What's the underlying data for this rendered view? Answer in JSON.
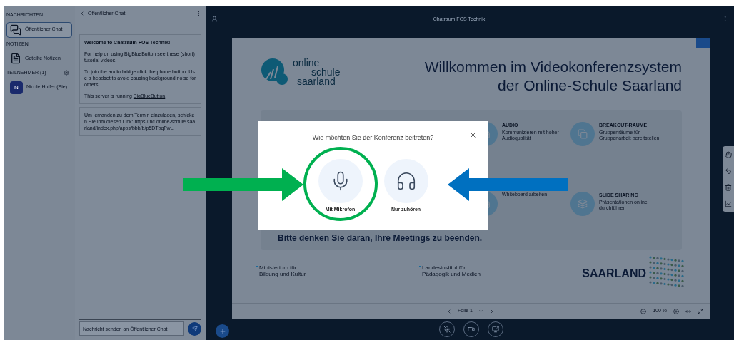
{
  "sidebar": {
    "sections": [
      {
        "title": "NACHRICHTEN",
        "items": [
          {
            "kind": "chat",
            "label": "Öffentlicher Chat",
            "selected": true
          }
        ]
      },
      {
        "title": "NOTIZEN",
        "items": [
          {
            "kind": "notes",
            "label": "Geteilte Notizen",
            "selected": false
          }
        ]
      },
      {
        "title": "TEILNEHMER (1)",
        "items": [
          {
            "kind": "user",
            "label": "Nicole Huffer (Sie)",
            "avatar": "N",
            "selected": false
          }
        ]
      }
    ]
  },
  "chat": {
    "title": "Öffentlicher Chat",
    "messages": [
      {
        "paragraphs": [
          {
            "kind": "bold",
            "before": "Welcome to Chatraum FOS Technik!"
          },
          {
            "kind": "plain",
            "before": "For help on using BigBlueButton see these (short) ",
            "link": "tutorial videos",
            "after": "."
          },
          {
            "kind": "plain",
            "before": "To join the audio bridge click the phone button. Use a headset to avoid causing background noise for others."
          },
          {
            "kind": "plain",
            "before": "This server is running ",
            "link": "BigBlueButton",
            "after": "."
          }
        ]
      },
      {
        "paragraphs": [
          {
            "kind": "plain",
            "before": "Um jemanden zu dem Termin einzuladen, schicken Sie ihm diesen Link: https://nc.online-schule.saarland/index.php/apps/bbb/b/p5DTbqFwL"
          }
        ]
      }
    ],
    "input": {
      "placeholder": "Nachricht senden an Öffentlicher Chat"
    }
  },
  "main": {
    "title": "Chatraum FOS Technik"
  },
  "slide": {
    "logo": [
      "online",
      "schule",
      "saarland"
    ],
    "heading": [
      "Willkommen im Videokonferenzsystem",
      "der Online-Schule Saarland"
    ],
    "features": [
      {
        "title": "AUDIO",
        "description": "Kommunizieren mit hoher Audioqualität"
      },
      {
        "title": "BREAKOUT-RÄUME",
        "description": "Gruppenräume für Gruppenarbeit bereitstellen"
      },
      {
        "description": "Whiteboard arbeiten"
      },
      {
        "title": "SLIDE SHARING",
        "description": "Präsentationen online durchführen"
      }
    ],
    "reminder": "Bitte denken Sie daran, Ihre Meetings zu beenden.",
    "footer": [
      [
        "Ministerium für",
        "Bildung und Kultur"
      ],
      [
        "Landesinstitut für",
        "Pädagogik und Medien"
      ]
    ],
    "brand": "SAARLAND"
  },
  "slide_toolbar": {
    "page": "Folie 1",
    "zoom": "100 %"
  },
  "dialog": {
    "question": "Wie möchten Sie der Konferenz beitreten?",
    "options": [
      {
        "kind": "microphone",
        "label": "Mit Mikrofon",
        "highlighted": true
      },
      {
        "kind": "listen",
        "label": "Nur zuhören",
        "highlighted": false
      }
    ]
  },
  "annotations": [
    {
      "kind": "arrow-right",
      "color": "#00b050"
    },
    {
      "kind": "arrow-left",
      "color": "#0070c0"
    }
  ]
}
